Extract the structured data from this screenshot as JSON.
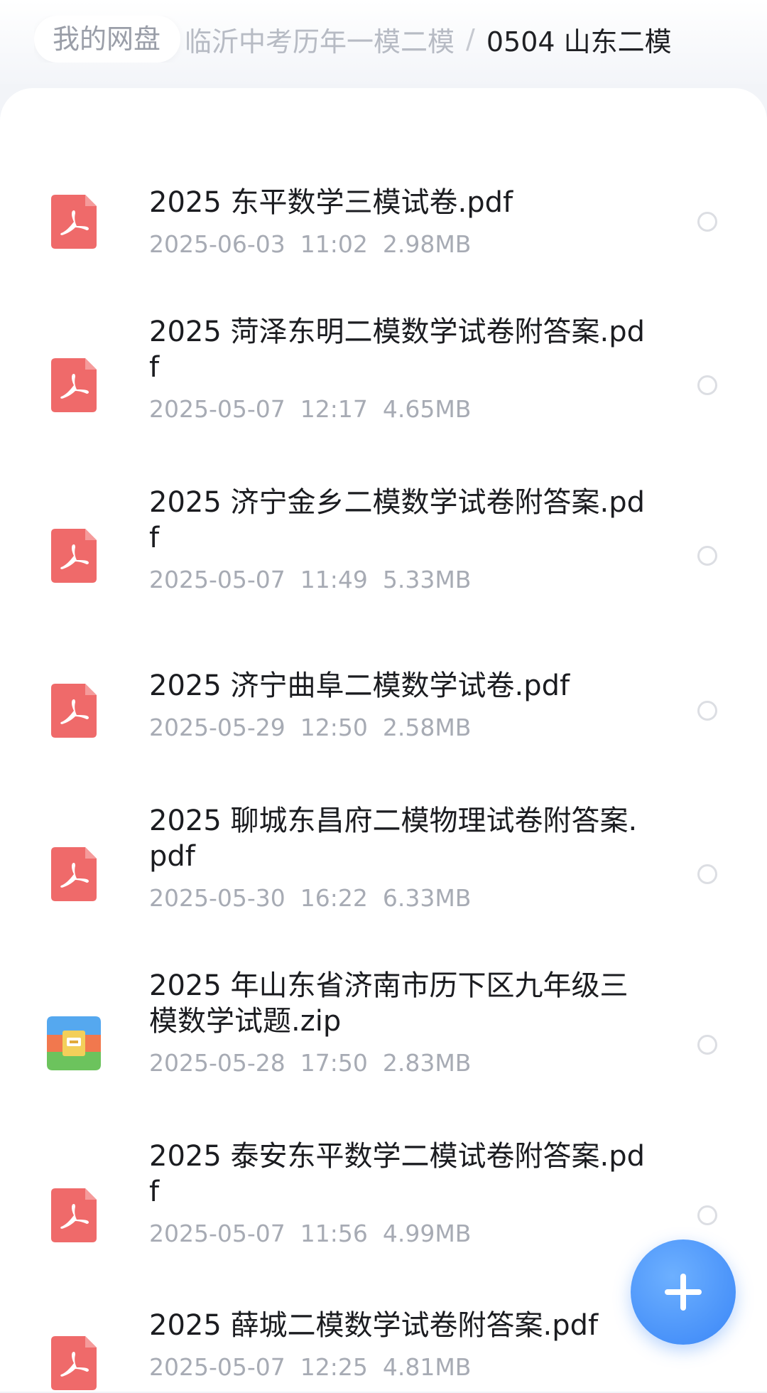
{
  "breadcrumb": {
    "root": "我的网盘",
    "middle": "临沂中考历年一模二模",
    "separator": "/",
    "current": "0504 山东二模"
  },
  "files": [
    {
      "name": "2025 东平数学三模试卷.pdf",
      "date": "2025-06-03",
      "time": "11:02",
      "size": "2.98MB",
      "type": "pdf"
    },
    {
      "name": "2025 菏泽东明二模数学试卷附答案.pdf",
      "date": "2025-05-07",
      "time": "12:17",
      "size": "4.65MB",
      "type": "pdf"
    },
    {
      "name": "2025 济宁金乡二模数学试卷附答案.pdf",
      "date": "2025-05-07",
      "time": "11:49",
      "size": "5.33MB",
      "type": "pdf"
    },
    {
      "name": "2025 济宁曲阜二模数学试卷.pdf",
      "date": "2025-05-29",
      "time": "12:50",
      "size": "2.58MB",
      "type": "pdf"
    },
    {
      "name": "2025 聊城东昌府二模物理试卷附答案.pdf",
      "date": "2025-05-30",
      "time": "16:22",
      "size": "6.33MB",
      "type": "pdf"
    },
    {
      "name": "2025 年山东省济南市历下区九年级三模数学试题.zip",
      "date": "2025-05-28",
      "time": "17:50",
      "size": "2.83MB",
      "type": "zip"
    },
    {
      "name": "2025 泰安东平数学二模试卷附答案.pdf",
      "date": "2025-05-07",
      "time": "11:56",
      "size": "4.99MB",
      "type": "pdf"
    },
    {
      "name": "2025 薛城二模数学试卷附答案.pdf",
      "date": "2025-05-07",
      "time": "12:25",
      "size": "4.81MB",
      "type": "pdf"
    }
  ],
  "colors": {
    "pdf_icon": "#ef6a6a",
    "zip_top": "#55a8ef",
    "zip_mid": "#f1784e",
    "zip_bottom": "#6cc35d",
    "fab": "#3a86f7"
  },
  "icons": {
    "pdf": "pdf-file-icon",
    "zip": "zip-archive-icon",
    "fab": "plus-icon"
  }
}
